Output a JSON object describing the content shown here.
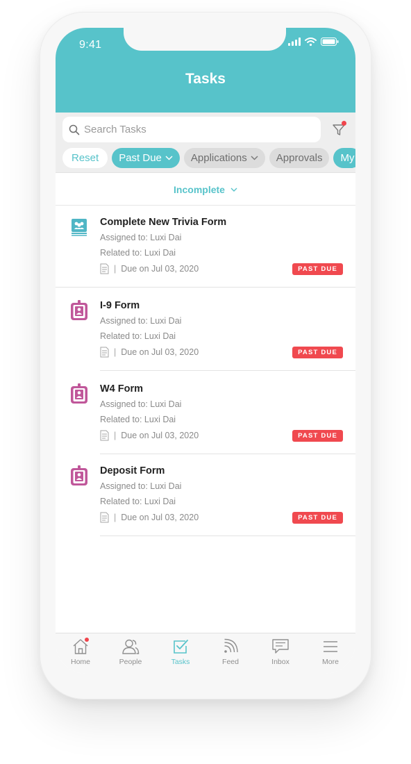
{
  "status_bar": {
    "time": "9:41"
  },
  "header": {
    "title": "Tasks"
  },
  "search": {
    "placeholder": "Search Tasks"
  },
  "filters": {
    "reset_label": "Reset",
    "chips": [
      "Past Due",
      "Applications",
      "Approvals",
      "My"
    ]
  },
  "status_filter": {
    "label": "Incomplete"
  },
  "tasks": [
    {
      "title": "Complete New Trivia Form",
      "assigned": "Assigned to: Luxi Dai",
      "related": "Related to: Luxi Dai",
      "due": "Due on Jul 03, 2020",
      "badge": "PAST DUE",
      "icon": "group-form-icon"
    },
    {
      "title": "I-9 Form",
      "assigned": "Assigned to: Luxi Dai",
      "related": "Related to: Luxi Dai",
      "due": "Due on Jul 03, 2020",
      "badge": "PAST DUE",
      "icon": "badge-id-icon"
    },
    {
      "title": "W4 Form",
      "assigned": "Assigned to: Luxi Dai",
      "related": "Related to: Luxi Dai",
      "due": "Due on Jul 03, 2020",
      "badge": "PAST DUE",
      "icon": "badge-id-icon"
    },
    {
      "title": "Deposit Form",
      "assigned": "Assigned to: Luxi Dai",
      "related": "Related to: Luxi Dai",
      "due": "Due on Jul 03, 2020",
      "badge": "PAST DUE",
      "icon": "badge-id-icon"
    }
  ],
  "tabbar": {
    "items": [
      {
        "label": "Home",
        "icon": "home-icon"
      },
      {
        "label": "People",
        "icon": "people-icon"
      },
      {
        "label": "Tasks",
        "icon": "tasks-icon",
        "active": true
      },
      {
        "label": "Feed",
        "icon": "rss-feed-icon"
      },
      {
        "label": "Inbox",
        "icon": "chat-bubble-icon"
      },
      {
        "label": "More",
        "icon": "menu-icon"
      }
    ]
  },
  "colors": {
    "accent": "#57c3ca",
    "past_due": "#f0494f",
    "form_icon": "#c0579a",
    "trivia_icon": "#4fb6c5"
  }
}
